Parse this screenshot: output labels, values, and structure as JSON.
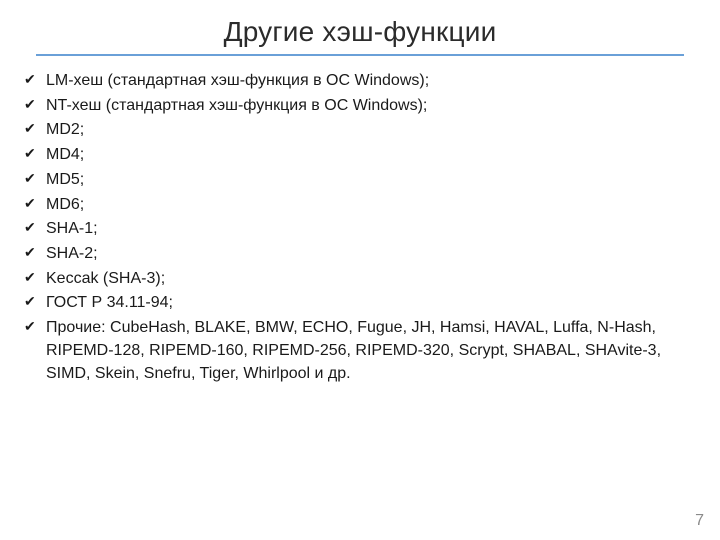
{
  "title": "Другие хэш-функции",
  "items": [
    "LM-хеш (стандартная хэш-функция в ОС Windows);",
    "NT-хеш (стандартная хэш-функция в ОС Windows);",
    "MD2;",
    "MD4;",
    "MD5;",
    "MD6;",
    "SHA-1;",
    "SHA-2;",
    "Keccak (SHA-3);",
    "ГОСТ Р 34.11-94;",
    "Прочие: CubeHash, BLAKE, BMW, ECHO, Fugue, JH, Hamsi, HAVAL, Luffa, N-Hash, RIPEMD-128, RIPEMD-160, RIPEMD-256, RIPEMD-320, Scrypt, SHABAL, SHAvite-3, SIMD, Skein, Snefru, Tiger, Whirlpool и др."
  ],
  "page_number": "7"
}
